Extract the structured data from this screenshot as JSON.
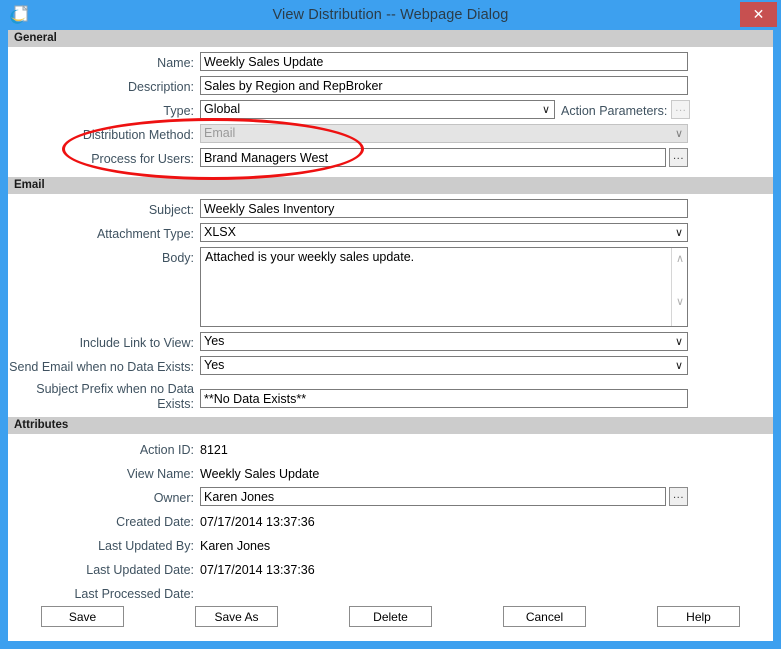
{
  "window": {
    "title": "View Distribution -- Webpage Dialog",
    "icon": "internet-explorer-icon",
    "close_label": "✕",
    "titlebar_color": "#3da0ef",
    "close_color": "#c75050"
  },
  "sections": {
    "general": {
      "header": "General",
      "name": {
        "label": "Name:",
        "value": "Weekly Sales Update"
      },
      "description": {
        "label": "Description:",
        "value": "Sales by Region and RepBroker"
      },
      "type": {
        "label": "Type:",
        "value": "Global"
      },
      "action_parameters": {
        "label": "Action Parameters:",
        "button": "..."
      },
      "distribution_method": {
        "label": "Distribution Method:",
        "value": "Email"
      },
      "process_for_users": {
        "label": "Process for Users:",
        "value": "Brand Managers West",
        "button": "..."
      }
    },
    "email": {
      "header": "Email",
      "subject": {
        "label": "Subject:",
        "value": "Weekly Sales Inventory"
      },
      "attachment_type": {
        "label": "Attachment Type:",
        "value": "XLSX"
      },
      "body": {
        "label": "Body:",
        "value": "Attached is your weekly sales update."
      },
      "include_link": {
        "label": "Include Link to View:",
        "value": "Yes"
      },
      "send_when_no_data": {
        "label": "Send Email when no Data Exists:",
        "value": "Yes"
      },
      "subject_prefix": {
        "label_line1": "Subject Prefix when no Data",
        "label_line2": "Exists:",
        "value": "**No Data Exists**"
      }
    },
    "attributes": {
      "header": "Attributes",
      "action_id": {
        "label": "Action ID:",
        "value": "8121"
      },
      "view_name": {
        "label": "View Name:",
        "value": "Weekly Sales Update"
      },
      "owner": {
        "label": "Owner:",
        "value": "Karen Jones",
        "button": "..."
      },
      "created_date": {
        "label": "Created Date:",
        "value": "07/17/2014 13:37:36"
      },
      "last_updated_by": {
        "label": "Last Updated By:",
        "value": "Karen Jones"
      },
      "last_updated_date": {
        "label": "Last Updated Date:",
        "value": "07/17/2014 13:37:36"
      },
      "last_processed_date": {
        "label": "Last Processed Date:",
        "value": ""
      }
    }
  },
  "buttons": {
    "save": "Save",
    "save_as": "Save As",
    "delete": "Delete",
    "cancel": "Cancel",
    "help": "Help"
  },
  "annotation": {
    "color": "#ee1111",
    "shape": "ellipse"
  },
  "scroll": {
    "up": "∧",
    "down": "∨"
  },
  "chevron": "∨"
}
